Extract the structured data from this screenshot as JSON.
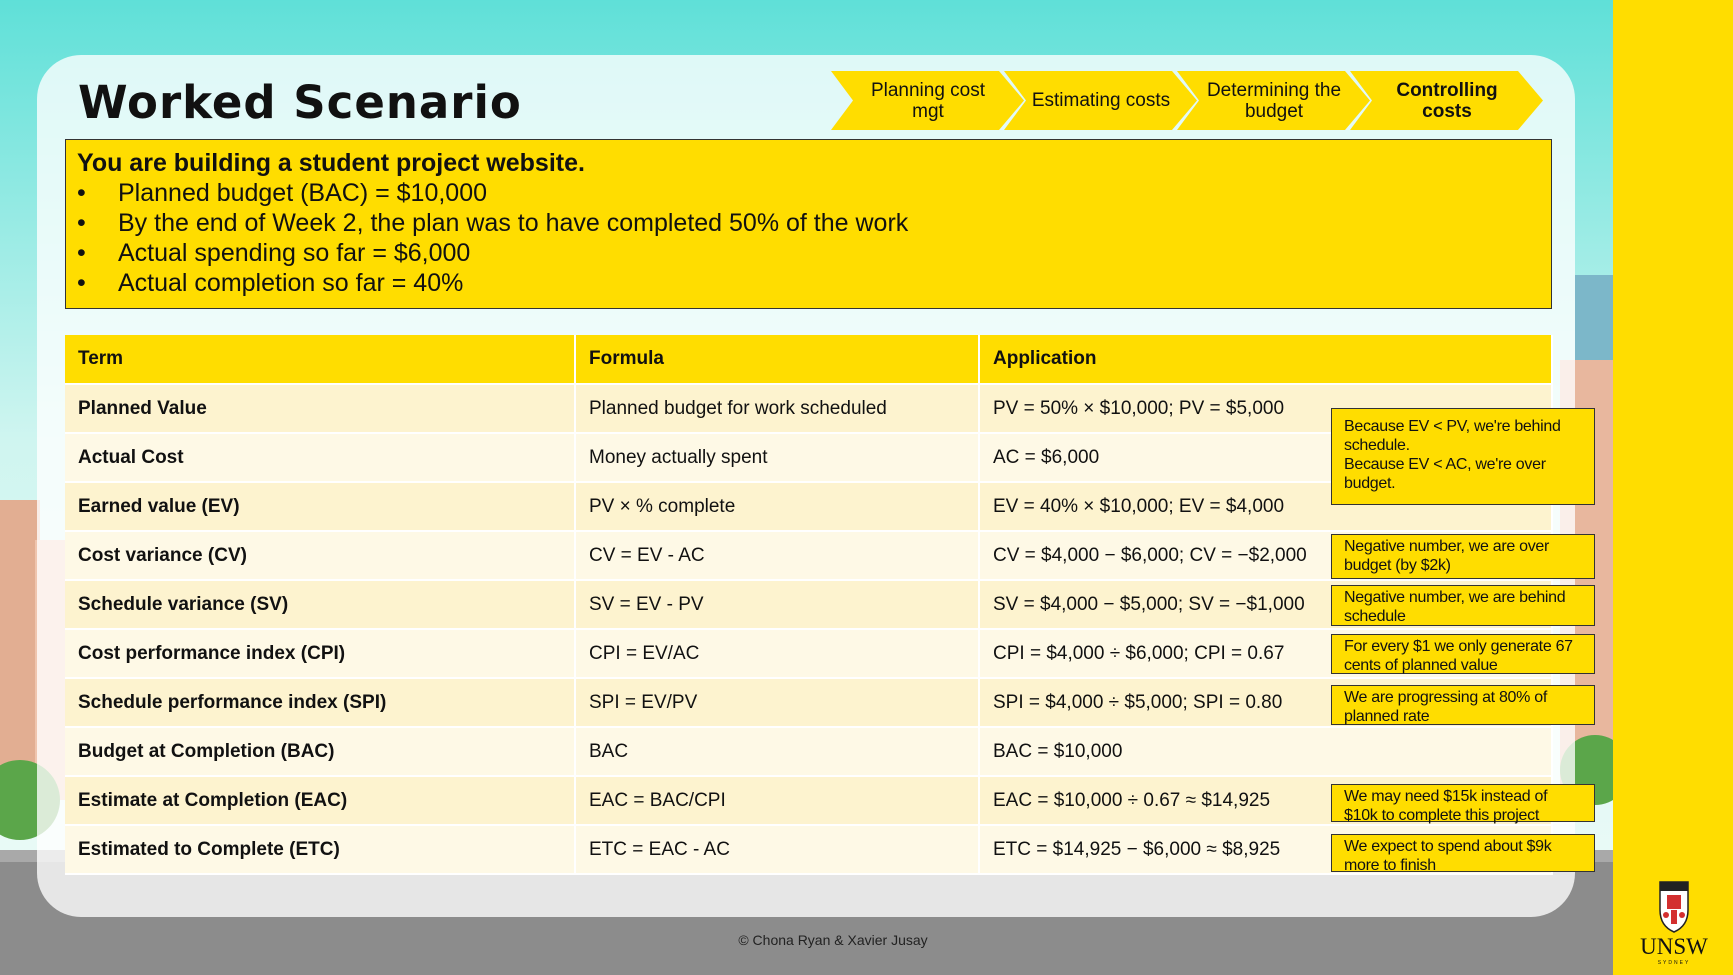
{
  "title": "Worked Scenario",
  "process_steps": [
    {
      "label": "Planning cost mgt",
      "active": false
    },
    {
      "label": "Estimating costs",
      "active": false
    },
    {
      "label": "Determining the budget",
      "active": false
    },
    {
      "label": "Controlling costs",
      "active": true
    }
  ],
  "scenario": {
    "heading": "You are building a student project website.",
    "bullets": [
      "Planned budget (BAC) = $10,000",
      "By the end of Week 2, the plan was to have completed 50% of the work",
      "Actual spending so far = $6,000",
      "Actual completion so far = 40%"
    ]
  },
  "table": {
    "headers": [
      "Term",
      "Formula",
      "Application"
    ],
    "rows": [
      [
        "Planned Value",
        "Planned budget for work scheduled",
        "PV = 50% × $10,000; PV = $5,000"
      ],
      [
        "Actual Cost",
        "Money actually spent",
        "AC = $6,000"
      ],
      [
        "Earned value (EV)",
        "PV × % complete",
        "EV = 40% × $10,000; EV = $4,000"
      ],
      [
        "Cost variance (CV)",
        "CV = EV - AC",
        "CV = $4,000 − $6,000; CV = −$2,000"
      ],
      [
        "Schedule variance (SV)",
        "SV = EV - PV",
        "SV = $4,000 − $5,000; SV = −$1,000"
      ],
      [
        "Cost performance index (CPI)",
        "CPI = EV/AC",
        "CPI = $4,000 ÷ $6,000; CPI = 0.67"
      ],
      [
        "Schedule performance index (SPI)",
        "SPI = EV/PV",
        "SPI = $4,000 ÷ $5,000; SPI = 0.80"
      ],
      [
        "Budget at Completion (BAC)",
        "BAC",
        "BAC = $10,000"
      ],
      [
        "Estimate at Completion (EAC)",
        "EAC = BAC/CPI",
        "EAC = $10,000 ÷ 0.67 ≈ $14,925"
      ],
      [
        "Estimated to Complete (ETC)",
        "ETC = EAC - AC",
        "ETC = $14,925 − $6,000 ≈ $8,925"
      ]
    ]
  },
  "notes": [
    "Because EV < PV, we're behind schedule.\nBecause EV < AC, we're over budget.",
    "Negative number, we are over budget (by $2k)",
    "Negative number, we are behind schedule",
    "For every $1 we only generate 67 cents of planned value",
    "We are progressing at 80% of planned rate",
    "We may need $15k instead of $10k to complete this project",
    "We expect to spend about $9k more to finish"
  ],
  "footer": "© Chona Ryan & Xavier Jusay",
  "logo": {
    "wordmark": "UNSW",
    "subtext": "SYDNEY",
    "icon": "unsw-crest-icon"
  },
  "colors": {
    "accent": "#FFDD00",
    "sky_top": "#5FE0D8",
    "row_a": "#FDF3CF",
    "row_b": "#FEF9E6"
  }
}
